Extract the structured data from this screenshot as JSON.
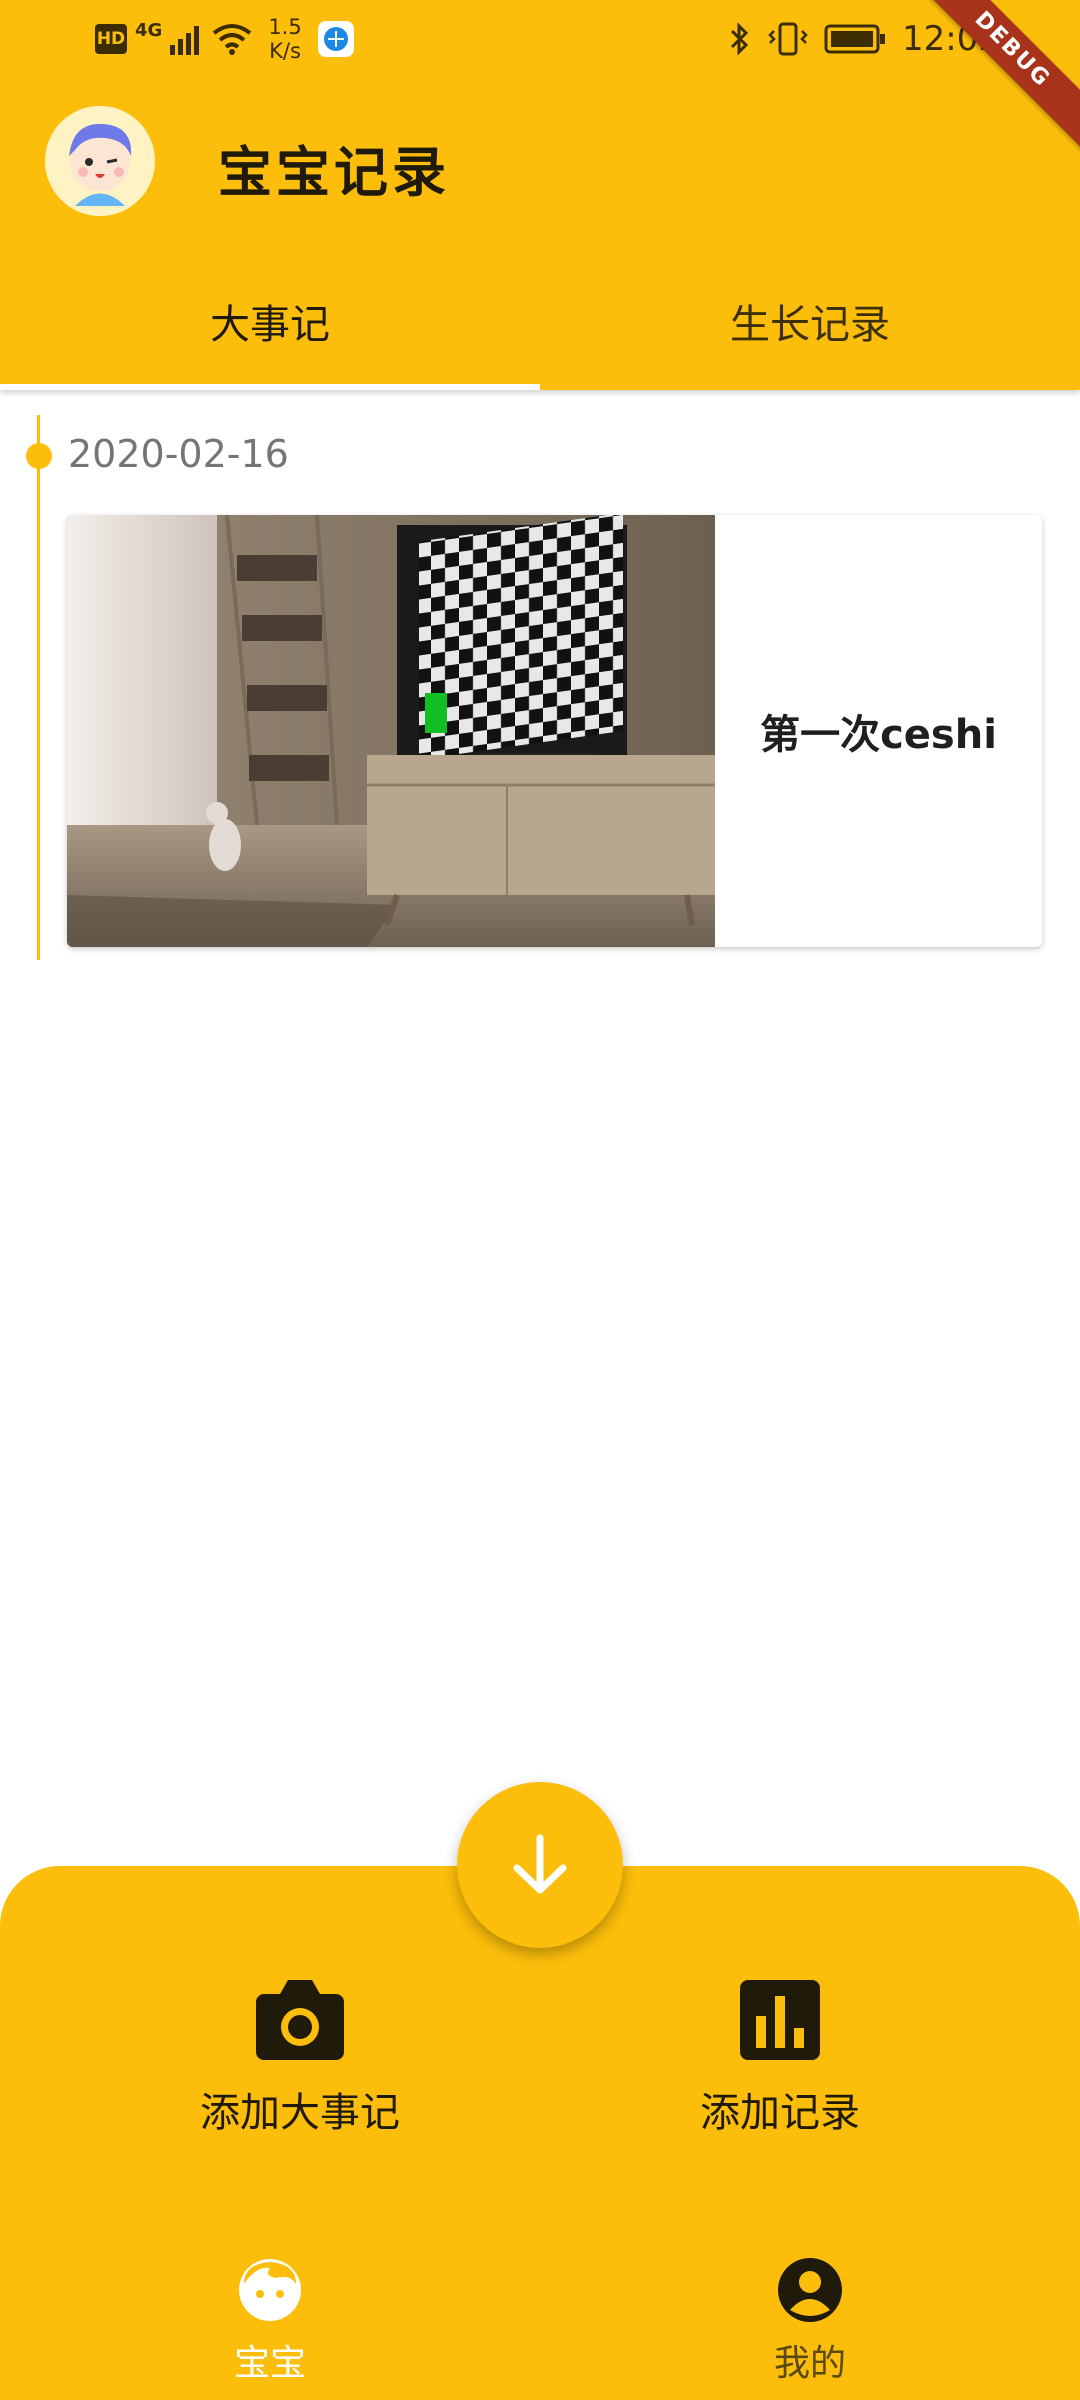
{
  "status_bar": {
    "hd": "HD",
    "network": "4G",
    "speed_value": "1.5",
    "speed_unit": "K/s",
    "time": "12:02"
  },
  "debug_banner": "DEBUG",
  "app_bar": {
    "title": "宝宝记录"
  },
  "tabs": [
    {
      "label": "大事记",
      "active": true
    },
    {
      "label": "生长记录",
      "active": false
    }
  ],
  "timeline": [
    {
      "date": "2020-02-16",
      "title": "第一次ceshi"
    }
  ],
  "actions": {
    "add_event": "添加大事记",
    "add_record": "添加记录"
  },
  "bottom_nav": [
    {
      "label": "宝宝",
      "active": true
    },
    {
      "label": "我的",
      "active": false
    }
  ],
  "colors": {
    "primary": "#fcbe0b",
    "text_dark": "#1f1a0a",
    "date_gray": "#757575",
    "debug_red": "#a8321a"
  }
}
